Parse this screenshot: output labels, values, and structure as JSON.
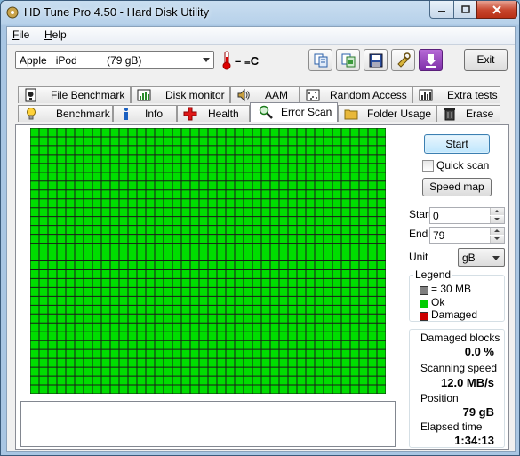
{
  "window": {
    "title": "HD Tune Pro 4.50 - Hard Disk Utility"
  },
  "menu": [
    {
      "label": "File",
      "accel": "F",
      "rest": "ile"
    },
    {
      "label": "Help",
      "accel": "H",
      "rest": "elp"
    }
  ],
  "toolbar": {
    "drive_selected": "Apple   iPod          (79 gB)",
    "temperature": "– ₌C",
    "temperature_text": "– ₌C",
    "buttons": [
      "copy-info-icon",
      "copy-screenshot-icon",
      "save-icon",
      "options-icon",
      "download-icon"
    ],
    "exit_label": "Exit"
  },
  "tabs_row1": [
    {
      "label": "File Benchmark",
      "icon": "file-benchmark-icon"
    },
    {
      "label": "Disk monitor",
      "icon": "disk-monitor-icon"
    },
    {
      "label": "AAM",
      "icon": "speaker-icon"
    },
    {
      "label": "Random Access",
      "icon": "random-access-icon"
    },
    {
      "label": "Extra tests",
      "icon": "extra-tests-icon"
    }
  ],
  "tabs_row2": [
    {
      "label": "Benchmark",
      "icon": "lightbulb-icon"
    },
    {
      "label": "Info",
      "icon": "info-icon"
    },
    {
      "label": "Health",
      "icon": "health-cross-icon"
    },
    {
      "label": "Error Scan",
      "icon": "magnifier-icon",
      "active": true
    },
    {
      "label": "Folder Usage",
      "icon": "folder-icon"
    },
    {
      "label": "Erase",
      "icon": "trash-icon"
    }
  ],
  "scan": {
    "grid_cols": 40,
    "grid_rows": 30,
    "grid_color": "#00dd00",
    "grid_line_color": "#1a1a1a",
    "start_button": "Start",
    "quick_scan_label": "Quick scan",
    "quick_scan_checked": false,
    "speed_map_button": "Speed map",
    "start_label": "Start",
    "start_value": "0",
    "end_label": "End",
    "end_value": "79",
    "unit_label": "Unit",
    "unit_value": "gB"
  },
  "legend": {
    "title": "Legend",
    "items": [
      {
        "label": "= 30 MB",
        "color": "#808080"
      },
      {
        "label": "Ok",
        "color": "#00cc00"
      },
      {
        "label": "Damaged",
        "color": "#cc0000"
      }
    ]
  },
  "stats": {
    "damaged_label": "Damaged blocks",
    "damaged_value": "0.0 %",
    "speed_label": "Scanning speed",
    "speed_value": "12.0 MB/s",
    "position_label": "Position",
    "position_value": "79 gB",
    "elapsed_label": "Elapsed time",
    "elapsed_value": "1:34:13"
  }
}
